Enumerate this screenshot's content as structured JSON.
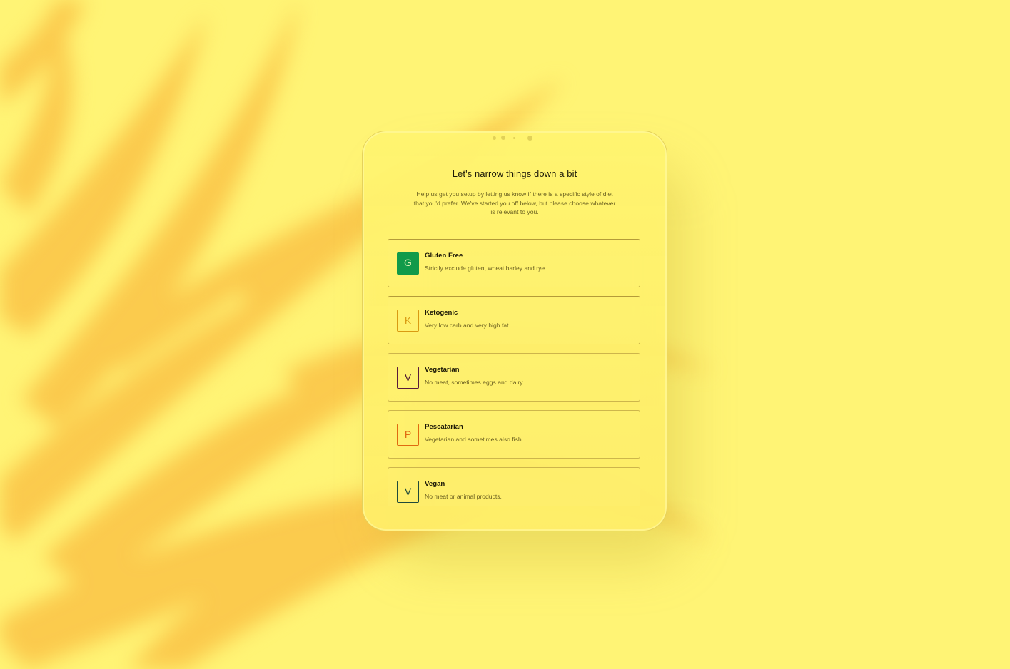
{
  "screen": {
    "title": "Let's narrow things down a bit",
    "subtitle": "Help us get you setup by letting us know if there is a specific style of diet that you'd prefer. We've started you off below, but please choose whatever is relevant to you."
  },
  "options": [
    {
      "letter": "G",
      "title": "Gluten Free",
      "description": "Strictly exclude gluten, wheat barley and rye.",
      "style": "filled",
      "color": "#119a4a",
      "selected": true
    },
    {
      "letter": "K",
      "title": "Ketogenic",
      "description": "Very low carb and very high fat.",
      "style": "outline",
      "color": "#d99a12",
      "selected": true
    },
    {
      "letter": "V",
      "title": "Vegetarian",
      "description": "No meat, sometimes eggs and dairy.",
      "style": "outline",
      "color": "#5a1a3a",
      "selected": false
    },
    {
      "letter": "P",
      "title": "Pescatarian",
      "description": "Vegetarian and sometimes also fish.",
      "style": "outline",
      "color": "#e06a10",
      "selected": false
    },
    {
      "letter": "V",
      "title": "Vegan",
      "description": "No meat or animal products.",
      "style": "outline",
      "color": "#1f4a3a",
      "selected": false
    }
  ],
  "colors": {
    "background": "#fff475",
    "shadow_leaves": "#fbc74a",
    "text_primary": "#1d1a08",
    "text_secondary": "#6e6422"
  }
}
